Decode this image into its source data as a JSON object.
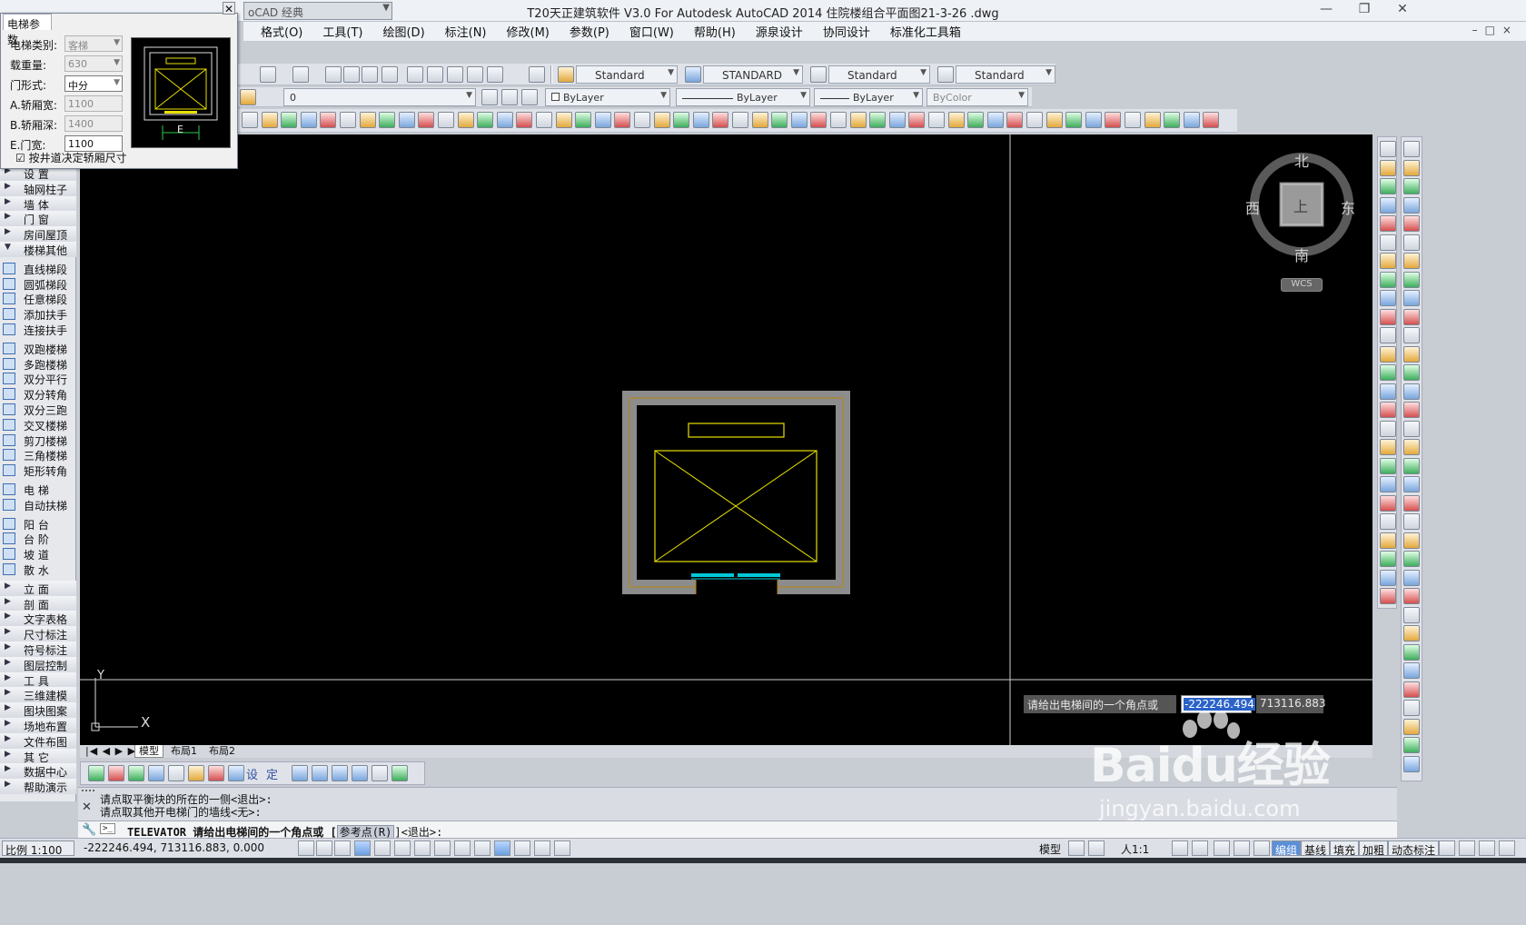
{
  "titlebar": {
    "title": "T20天正建筑软件 V3.0 For Autodesk AutoCAD 2014    住院楼组合平面图21-3-26 .dwg",
    "workspace": "oCAD 经典",
    "minimize": "—",
    "restore": "❐",
    "close": "✕"
  },
  "menubar": {
    "items": [
      "格式(O)",
      "工具(T)",
      "绘图(D)",
      "标注(N)",
      "修改(M)",
      "参数(P)",
      "窗口(W)",
      "帮助(H)",
      "源泉设计",
      "协同设计",
      "标准化工具箱"
    ],
    "right_controls": "–□×"
  },
  "toolbar2": {
    "text_style": "Standard",
    "dim_style": "STANDARD",
    "table_style": "Standard",
    "mleader_style": "Standard"
  },
  "toolbar3": {
    "layer": "0",
    "color": "ByLayer",
    "linetype": "ByLayer",
    "lineweight": "ByLayer",
    "plotstyle": "ByColor"
  },
  "dialog": {
    "title": "电梯参数",
    "close": "✕",
    "fields": [
      {
        "label": "电梯类别:",
        "value": "客梯",
        "dropdown": true,
        "active": false
      },
      {
        "label": "载重量:",
        "value": "630",
        "dropdown": true,
        "active": false
      },
      {
        "label": "门形式:",
        "value": "中分",
        "dropdown": true,
        "active": true
      },
      {
        "label": "A.轿厢宽:",
        "value": "1100",
        "dropdown": false,
        "active": false
      },
      {
        "label": "B.轿厢深:",
        "value": "1400",
        "dropdown": false,
        "active": false
      },
      {
        "label": "E.门宽:",
        "value": "1100",
        "dropdown": false,
        "active": true
      }
    ],
    "checkbox_label": "按井道决定轿厢尺寸",
    "checkbox_mark": "☑",
    "preview_label": "E"
  },
  "leftpanel": {
    "items": [
      {
        "type": "header",
        "label": "设   置"
      },
      {
        "type": "header",
        "label": "轴网柱子"
      },
      {
        "type": "header",
        "label": "墙   体"
      },
      {
        "type": "header",
        "label": "门   窗"
      },
      {
        "type": "header",
        "label": "房间屋顶"
      },
      {
        "type": "header-open",
        "label": "楼梯其他"
      },
      {
        "type": "tool",
        "label": "直线梯段"
      },
      {
        "type": "tool",
        "label": "圆弧梯段"
      },
      {
        "type": "tool",
        "label": "任意梯段"
      },
      {
        "type": "tool",
        "label": "添加扶手"
      },
      {
        "type": "tool",
        "label": "连接扶手"
      },
      {
        "type": "tool",
        "label": "双跑楼梯"
      },
      {
        "type": "tool",
        "label": "多跑楼梯"
      },
      {
        "type": "tool",
        "label": "双分平行"
      },
      {
        "type": "tool",
        "label": "双分转角"
      },
      {
        "type": "tool",
        "label": "双分三跑"
      },
      {
        "type": "tool",
        "label": "交叉楼梯"
      },
      {
        "type": "tool",
        "label": "剪刀楼梯"
      },
      {
        "type": "tool",
        "label": "三角楼梯"
      },
      {
        "type": "tool",
        "label": "矩形转角"
      },
      {
        "type": "tool",
        "label": "电   梯"
      },
      {
        "type": "tool",
        "label": "自动扶梯"
      },
      {
        "type": "tool",
        "label": "阳   台"
      },
      {
        "type": "tool",
        "label": "台   阶"
      },
      {
        "type": "tool",
        "label": "坡   道"
      },
      {
        "type": "tool",
        "label": "散   水"
      },
      {
        "type": "header",
        "label": "立   面"
      },
      {
        "type": "header",
        "label": "剖   面"
      },
      {
        "type": "header",
        "label": "文字表格"
      },
      {
        "type": "header",
        "label": "尺寸标注"
      },
      {
        "type": "header",
        "label": "符号标注"
      },
      {
        "type": "header",
        "label": "图层控制"
      },
      {
        "type": "header",
        "label": "工   具"
      },
      {
        "type": "header",
        "label": "三维建模"
      },
      {
        "type": "header",
        "label": "图块图案"
      },
      {
        "type": "header",
        "label": "场地布置"
      },
      {
        "type": "header",
        "label": "文件布图"
      },
      {
        "type": "header",
        "label": "其   它"
      },
      {
        "type": "header",
        "label": "数据中心"
      },
      {
        "type": "header",
        "label": "帮助演示"
      }
    ]
  },
  "compass": {
    "north": "北",
    "south": "南",
    "east": "东",
    "west": "西",
    "center": "上",
    "wcs": "WCS"
  },
  "ucs": {
    "x": "X",
    "y": "Y"
  },
  "layout_tabs": {
    "nav": "|◀ ◀ ▶ ▶|",
    "tabs": [
      "模型",
      "布局1",
      "布局2"
    ],
    "active": "模型"
  },
  "dynamic_input": {
    "prompt": "请给出电梯间的一个角点或",
    "x_value": "-222246.494",
    "y_value": "713116.883"
  },
  "bottom_strip": {
    "text_buttons": [
      "设",
      "定"
    ]
  },
  "command": {
    "history": [
      "请点取平衡块的所在的一侧<退出>:",
      "请点取其他开电梯门的墙线<无>:"
    ],
    "prompt_prefix": "TELEVATOR 请给出电梯间的一个角点或 [",
    "option": "参考点(R)",
    "prompt_suffix": "]<退出>:"
  },
  "statusbar": {
    "scale": "比例 1:100",
    "coords": "-222246.494, 713116.883, 0.000",
    "model": "模型",
    "annoscale": "人1:1",
    "toggles": [
      "编组",
      "基线",
      "填充",
      "加粗",
      "动态标注"
    ]
  },
  "watermark": {
    "brand": "Baidu经验",
    "url": "jingyan.baidu.com"
  },
  "colors": {
    "canvas": "#000000",
    "elevator_lines": "#e8e000",
    "door": "#00c8d8",
    "wall_fill": "#8c8c8c",
    "accent": "#2a62c8"
  }
}
